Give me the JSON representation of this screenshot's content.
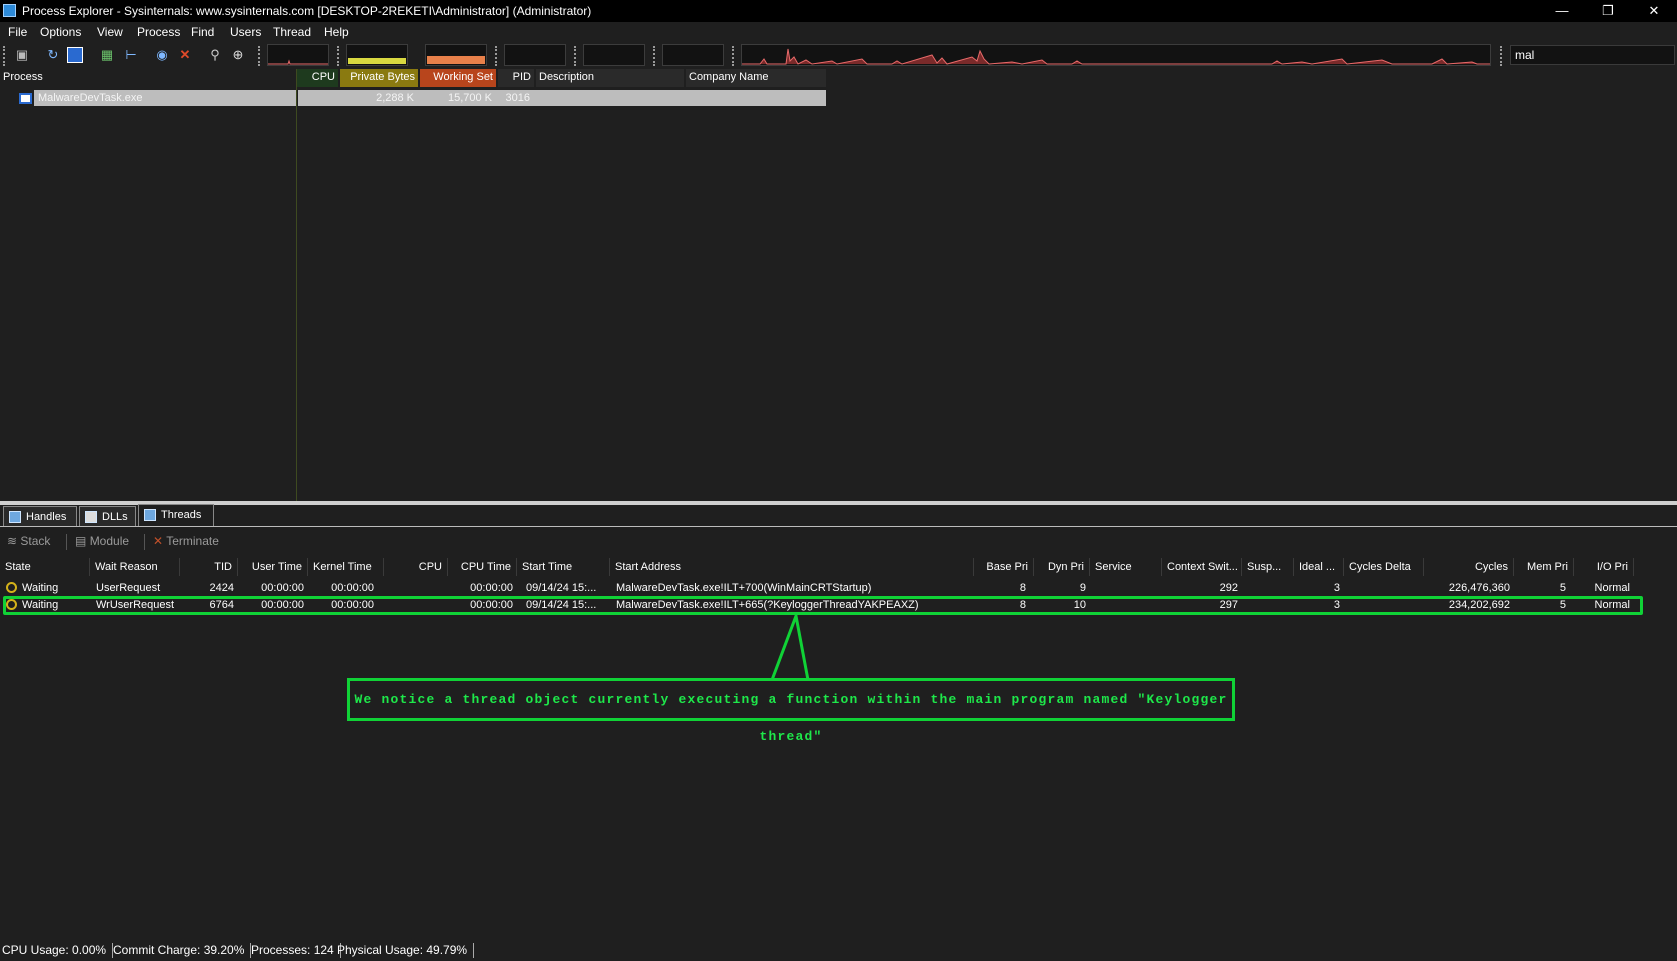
{
  "window": {
    "title": "Process Explorer - Sysinternals: www.sysinternals.com [DESKTOP-2REKETI\\Administrator] (Administrator)",
    "minimize": "—",
    "restore": "❐",
    "close": "✕"
  },
  "menu": [
    "File",
    "Options",
    "View",
    "Process",
    "Find",
    "Users",
    "Thread",
    "Help"
  ],
  "toolbar": {
    "icons": [
      "save-icon",
      "refresh-icon",
      "window-icon",
      "sysinfo-icon",
      "tree-icon",
      "target-icon",
      "kill-icon",
      "find-icon",
      "crosshair-icon"
    ],
    "search_value": "mal"
  },
  "process_list": {
    "columns": [
      "Process",
      "CPU",
      "Private Bytes",
      "Working Set",
      "PID",
      "Description",
      "Company Name"
    ],
    "rows": [
      {
        "name": "MalwareDevTask.exe",
        "cpu": "",
        "private_bytes": "2,288 K",
        "working_set": "15,700 K",
        "pid": "3016",
        "description": "",
        "company": ""
      }
    ]
  },
  "tabs": [
    "Handles",
    "DLLs",
    "Threads"
  ],
  "active_tab": "Threads",
  "thread_toolbar": [
    "Stack",
    "Module",
    "Terminate"
  ],
  "threads": {
    "columns": [
      "State",
      "Wait Reason",
      "TID",
      "User Time",
      "Kernel Time",
      "CPU",
      "CPU Time",
      "Start Time",
      "Start Address",
      "Base Pri",
      "Dyn Pri",
      "Service",
      "Context Swit...",
      "Susp...",
      "Ideal ...",
      "Cycles Delta",
      "Cycles",
      "Mem Pri",
      "I/O Pri"
    ],
    "rows": [
      {
        "state": "Waiting",
        "wait_reason": "UserRequest",
        "tid": "2424",
        "user_time": "00:00:00",
        "kernel_time": "00:00:00",
        "cpu": "",
        "cpu_time": "00:00:00",
        "start_time": "09/14/24 15:...",
        "start_address": "MalwareDevTask.exe!ILT+700(WinMainCRTStartup)",
        "base_pri": "8",
        "dyn_pri": "9",
        "service": "",
        "context_switches": "292",
        "suspend": "",
        "ideal": "3",
        "cycles_delta": "",
        "cycles": "226,476,360",
        "mem_pri": "5",
        "io_pri": "Normal"
      },
      {
        "state": "Waiting",
        "wait_reason": "WrUserRequest",
        "tid": "6764",
        "user_time": "00:00:00",
        "kernel_time": "00:00:00",
        "cpu": "",
        "cpu_time": "00:00:00",
        "start_time": "09/14/24 15:...",
        "start_address": "MalwareDevTask.exe!ILT+665(?KeyloggerThreadYAKPEAXZ)",
        "base_pri": "8",
        "dyn_pri": "10",
        "service": "",
        "context_switches": "297",
        "suspend": "",
        "ideal": "3",
        "cycles_delta": "",
        "cycles": "234,202,692",
        "mem_pri": "5",
        "io_pri": "Normal"
      }
    ]
  },
  "annotation": {
    "text": "We notice a thread object currently executing a function within the main program named \"Keylogger thread\"",
    "color": "#10d236"
  },
  "status": {
    "cpu": "CPU Usage: 0.00%",
    "commit": "Commit Charge: 39.20%",
    "processes": "Processes: 124",
    "physical": "Physical Usage: 49.79%"
  },
  "colors": {
    "cpu_header": "#1e3a1e",
    "private_bytes_header": "#8a7a10",
    "working_set_header": "#b8451c",
    "graph_private": "#d8d840",
    "graph_working": "#e8804a",
    "graph_cpu": "#e86a6a"
  }
}
